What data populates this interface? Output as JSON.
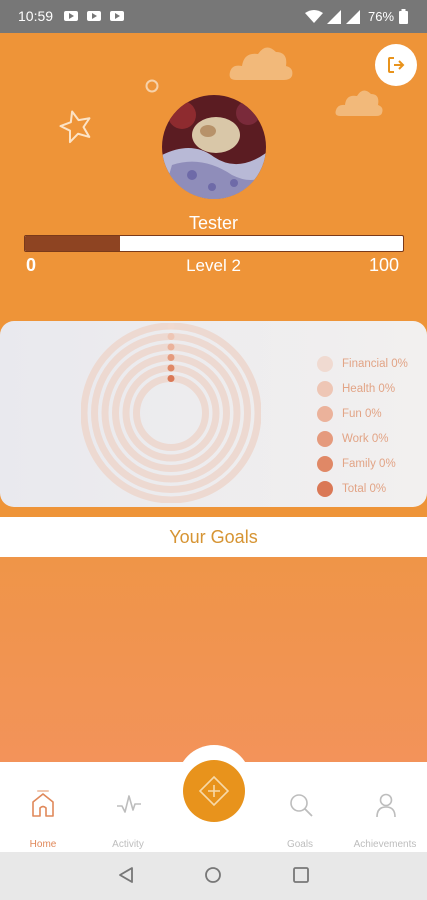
{
  "status_bar": {
    "time": "10:59",
    "battery_percent": "76%",
    "icons": [
      "youtube-notification-icon",
      "youtube-notification-icon",
      "youtube-notification-icon",
      "wifi-icon",
      "signal-icon",
      "signal-icon",
      "battery-icon"
    ]
  },
  "profile": {
    "username": "Tester",
    "avatar_icon": "avatar-photo",
    "logout_icon": "logout-icon"
  },
  "xp": {
    "min_label": "0",
    "max_label": "100",
    "level_label": "Level 2",
    "progress_fraction": 0.25
  },
  "progress_chart": {
    "legend": [
      {
        "label": "Financial 0%",
        "color": "#F0DAD1"
      },
      {
        "label": "Health 0%",
        "color": "#EEC6B5"
      },
      {
        "label": "Fun 0%",
        "color": "#EBB29B"
      },
      {
        "label": "Work 0%",
        "color": "#E59A7D"
      },
      {
        "label": "Family 0%",
        "color": "#E08866"
      },
      {
        "label": "Total 0%",
        "color": "#DA7856"
      }
    ]
  },
  "goals": {
    "title": "Your Goals"
  },
  "bottom_nav": {
    "items": [
      {
        "label": "Home",
        "icon": "home-icon",
        "active": true
      },
      {
        "label": "Activity",
        "icon": "activity-icon",
        "active": false
      },
      {
        "label": "Goals",
        "icon": "search-icon",
        "active": false
      },
      {
        "label": "Achievements",
        "icon": "person-icon",
        "active": false
      }
    ],
    "fab_icon": "add-goal-icon"
  },
  "colors": {
    "accent": "#EE9438",
    "fab": "#E8931C",
    "goals_title": "#D69433",
    "xp_fill": "#8E4422"
  }
}
